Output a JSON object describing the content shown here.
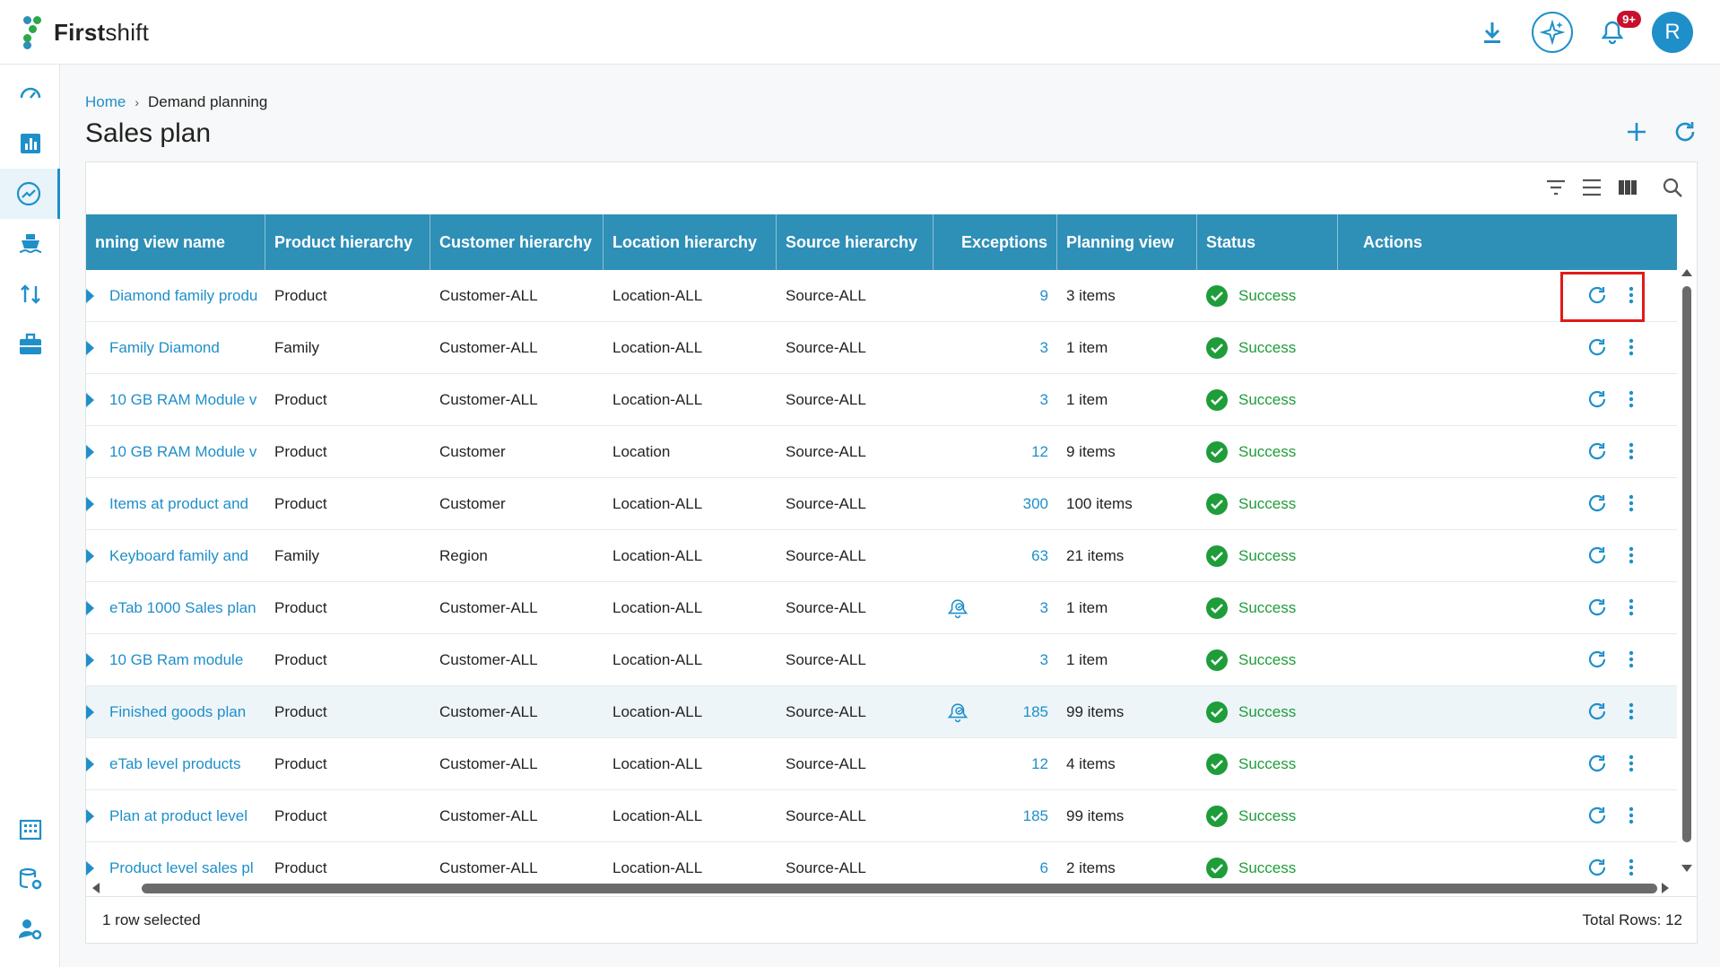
{
  "app": {
    "logo_bold": "First",
    "logo_rest": "shift",
    "notifications_badge": "9+",
    "avatar_initial": "R"
  },
  "breadcrumb": {
    "home": "Home",
    "current": "Demand planning"
  },
  "page": {
    "title": "Sales plan"
  },
  "table": {
    "headers": {
      "name": "nning view name",
      "product": "Product hierarchy",
      "customer": "Customer hierarchy",
      "location": "Location hierarchy",
      "source": "Source hierarchy",
      "exceptions": "Exceptions",
      "planning_view": "Planning view",
      "status": "Status",
      "actions": "Actions"
    },
    "rows": [
      {
        "name": "Diamond family produ",
        "product": "Product",
        "customer": "Customer-ALL",
        "location": "Location-ALL",
        "source": "Source-ALL",
        "alert": false,
        "exceptions": "9",
        "planning_view": "3 items",
        "status": "Success"
      },
      {
        "name": "Family Diamond",
        "product": "Family",
        "customer": "Customer-ALL",
        "location": "Location-ALL",
        "source": "Source-ALL",
        "alert": false,
        "exceptions": "3",
        "planning_view": "1 item",
        "status": "Success"
      },
      {
        "name": "10 GB RAM Module v",
        "product": "Product",
        "customer": "Customer-ALL",
        "location": "Location-ALL",
        "source": "Source-ALL",
        "alert": false,
        "exceptions": "3",
        "planning_view": "1 item",
        "status": "Success"
      },
      {
        "name": "10 GB RAM Module v",
        "product": "Product",
        "customer": "Customer",
        "location": "Location",
        "source": "Source-ALL",
        "alert": false,
        "exceptions": "12",
        "planning_view": "9 items",
        "status": "Success"
      },
      {
        "name": "Items at product and",
        "product": "Product",
        "customer": "Customer",
        "location": "Location-ALL",
        "source": "Source-ALL",
        "alert": false,
        "exceptions": "300",
        "planning_view": "100 items",
        "status": "Success"
      },
      {
        "name": "Keyboard family and",
        "product": "Family",
        "customer": "Region",
        "location": "Location-ALL",
        "source": "Source-ALL",
        "alert": false,
        "exceptions": "63",
        "planning_view": "21 items",
        "status": "Success"
      },
      {
        "name": "eTab 1000 Sales plan",
        "product": "Product",
        "customer": "Customer-ALL",
        "location": "Location-ALL",
        "source": "Source-ALL",
        "alert": true,
        "exceptions": "3",
        "planning_view": "1 item",
        "status": "Success"
      },
      {
        "name": "10 GB Ram module",
        "product": "Product",
        "customer": "Customer-ALL",
        "location": "Location-ALL",
        "source": "Source-ALL",
        "alert": false,
        "exceptions": "3",
        "planning_view": "1 item",
        "status": "Success"
      },
      {
        "name": "Finished goods plan",
        "product": "Product",
        "customer": "Customer-ALL",
        "location": "Location-ALL",
        "source": "Source-ALL",
        "alert": true,
        "exceptions": "185",
        "planning_view": "99 items",
        "status": "Success",
        "selected": true
      },
      {
        "name": "eTab level products",
        "product": "Product",
        "customer": "Customer-ALL",
        "location": "Location-ALL",
        "source": "Source-ALL",
        "alert": false,
        "exceptions": "12",
        "planning_view": "4 items",
        "status": "Success"
      },
      {
        "name": "Plan at product level",
        "product": "Product",
        "customer": "Customer-ALL",
        "location": "Location-ALL",
        "source": "Source-ALL",
        "alert": false,
        "exceptions": "185",
        "planning_view": "99 items",
        "status": "Success"
      },
      {
        "name": "Product level sales pl",
        "product": "Product",
        "customer": "Customer-ALL",
        "location": "Location-ALL",
        "source": "Source-ALL",
        "alert": false,
        "exceptions": "6",
        "planning_view": "2 items",
        "status": "Success"
      }
    ]
  },
  "footer": {
    "selected": "1 row selected",
    "total": "Total Rows: 12"
  },
  "colors": {
    "accent": "#1f8fc9",
    "header": "#2e8fb7",
    "success": "#1e9d3a",
    "highlight": "#e01a1a"
  }
}
